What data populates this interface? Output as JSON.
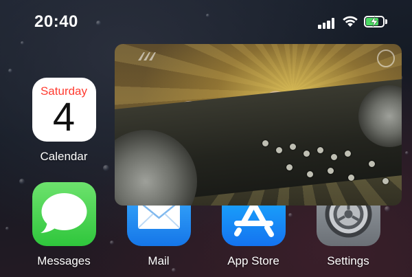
{
  "status_bar": {
    "time": "20:40",
    "signal_icon": "cellular-signal-icon",
    "wifi_icon": "wifi-icon",
    "battery_icon": "battery-charging-icon",
    "battery_color": "#4cd964"
  },
  "apps": {
    "calendar": {
      "label": "Calendar",
      "weekday": "Saturday",
      "date": "4",
      "icon": "calendar-icon",
      "accent": "#ff3b30"
    },
    "messages": {
      "label": "Messages",
      "icon": "speech-bubble-icon"
    },
    "mail": {
      "label": "Mail",
      "icon": "envelope-icon"
    },
    "app_store": {
      "label": "App Store",
      "icon": "app-store-icon"
    },
    "settings": {
      "label": "Settings",
      "icon": "gear-icon"
    }
  },
  "pip_video": {
    "description_icon": "dj-mixer-video"
  }
}
